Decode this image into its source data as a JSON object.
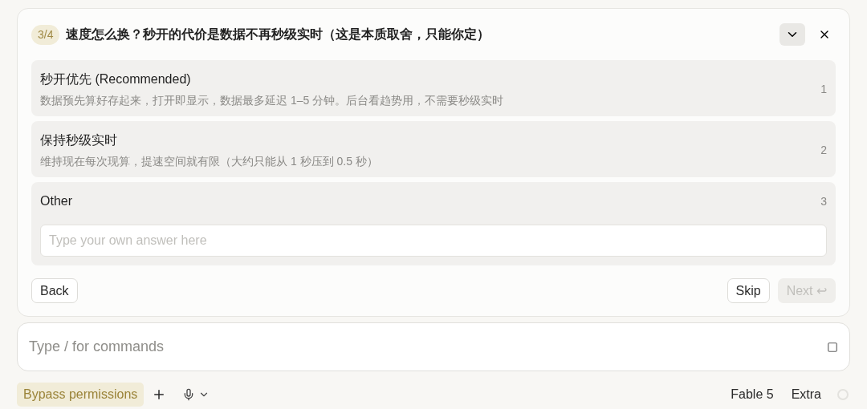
{
  "question": {
    "step": "3/4",
    "title": "速度怎么换？秒开的代价是数据不再秒级实时（这是本质取舍，只能你定）"
  },
  "options": [
    {
      "kind": "choice",
      "label": "秒开优先 (Recommended)",
      "description": "数据预先算好存起来，打开即显示，数据最多延迟 1–5 分钟。后台看趋势用，不需要秒级实时",
      "number": "1"
    },
    {
      "kind": "choice",
      "label": "保持秒级实时",
      "description": "维持现在每次现算，提速空间就有限（大约只能从 1 秒压到 0.5 秒）",
      "number": "2"
    },
    {
      "kind": "other",
      "label": "Other",
      "number": "3",
      "placeholder": "Type your own answer here"
    }
  ],
  "actions": {
    "back": "Back",
    "skip": "Skip",
    "next": {
      "label": "Next ↩",
      "disabled": true
    }
  },
  "composer": {
    "placeholder": "Type / for commands"
  },
  "footer": {
    "mode": "Bypass permissions",
    "model": "Fable 5",
    "effort": "Extra"
  }
}
